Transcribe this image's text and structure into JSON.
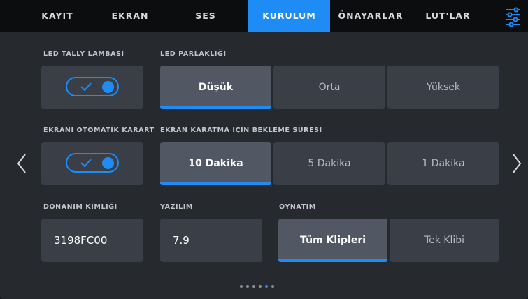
{
  "tabs": [
    {
      "label": "KAYIT",
      "active": false
    },
    {
      "label": "EKRAN",
      "active": false
    },
    {
      "label": "SES",
      "active": false
    },
    {
      "label": "KURULUM",
      "active": true
    },
    {
      "label": "ÖNAYARLAR",
      "active": false
    },
    {
      "label": "LUT'LAR",
      "active": false
    }
  ],
  "settings_icon": "settings-sliders-icon",
  "led_tally": {
    "label": "LED TALLY LAMBASI",
    "on": true
  },
  "led_brightness": {
    "label": "LED PARLAKLIĞI",
    "options": [
      "Düşük",
      "Orta",
      "Yüksek"
    ],
    "selected": "Düşük"
  },
  "auto_dim": {
    "label": "EKRANI OTOMATİK KARART",
    "on": true
  },
  "dim_wait": {
    "label": "EKRAN KARATMA IÇIN BEKLEME SÜRESI",
    "options": [
      "10 Dakika",
      "5 Dakika",
      "1 Dakika"
    ],
    "selected": "10 Dakika"
  },
  "hardware_id": {
    "label": "DONANIM KİMLİĞİ",
    "value": "3198FC00"
  },
  "software": {
    "label": "YAZILIM",
    "value": "7.9"
  },
  "playback": {
    "label": "OYNATIM",
    "options": [
      "Tüm Klipleri",
      "Tek Klibi"
    ],
    "selected": "Tüm Klipleri"
  },
  "pagination": {
    "total": 6,
    "current": 5
  },
  "colors": {
    "accent": "#1f8cf5",
    "background": "#26292e",
    "tabbar": "#0c0d0f",
    "cell": "#3a3f47",
    "cell_selected": "#515864"
  }
}
